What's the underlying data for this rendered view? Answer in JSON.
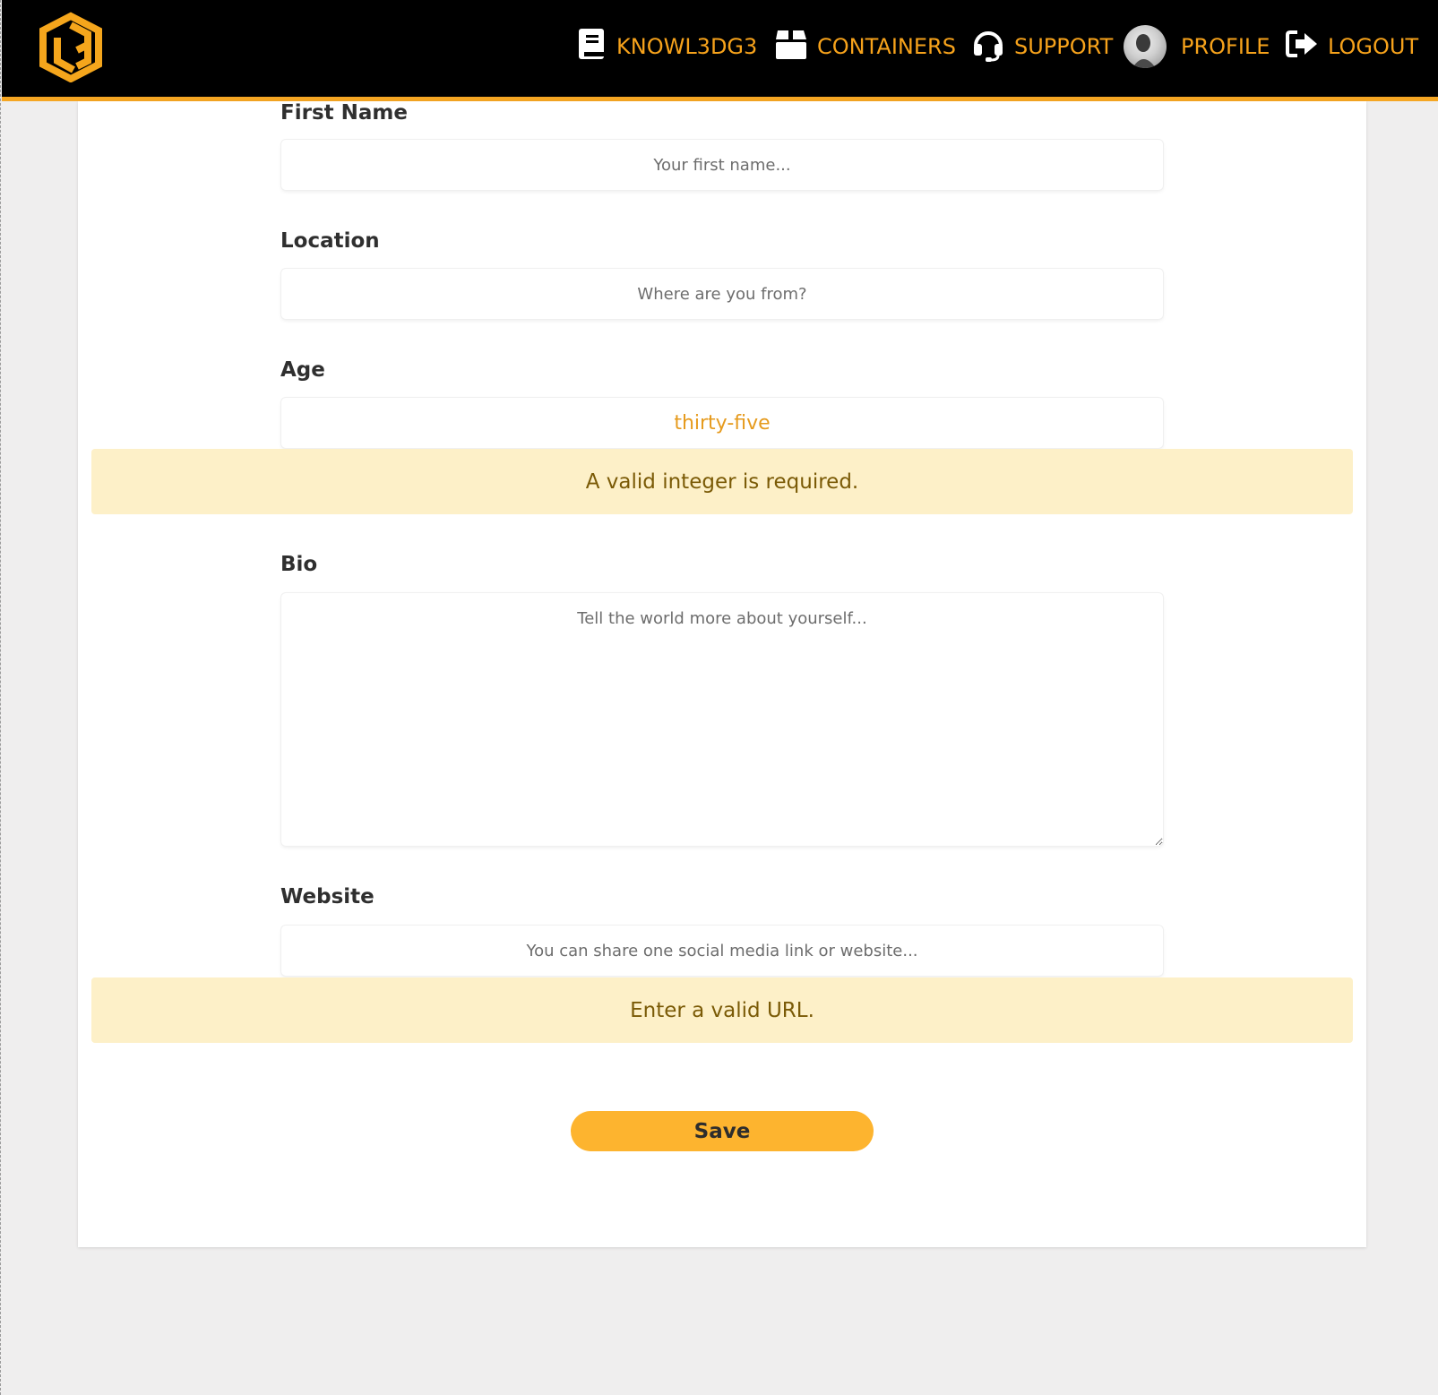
{
  "nav": {
    "items": [
      {
        "label": "KNOWL3DG3",
        "icon": "book-icon"
      },
      {
        "label": "CONTAINERS",
        "icon": "box-icon"
      },
      {
        "label": "SUPPORT",
        "icon": "headset-icon"
      },
      {
        "label": "PROFILE",
        "icon": "avatar"
      },
      {
        "label": "LOGOUT",
        "icon": "sign-out-icon"
      }
    ],
    "accent_color": "#f6a21b",
    "bar_color": "#000000"
  },
  "form": {
    "first_name": {
      "label": "First Name",
      "placeholder": "Your first name..."
    },
    "location": {
      "label": "Location",
      "placeholder": "Where are you from?"
    },
    "age": {
      "label": "Age",
      "value": "thirty-five",
      "error": "A valid integer is required."
    },
    "bio": {
      "label": "Bio",
      "placeholder": "Tell the world more about yourself..."
    },
    "website": {
      "label": "Website",
      "placeholder": "You can share one social media link or website...",
      "error": "Enter a valid URL."
    },
    "save_label": "Save"
  },
  "colors": {
    "alert_bg": "#fdf0c8",
    "alert_text": "#7a5a06",
    "button": "#fdb42f"
  }
}
